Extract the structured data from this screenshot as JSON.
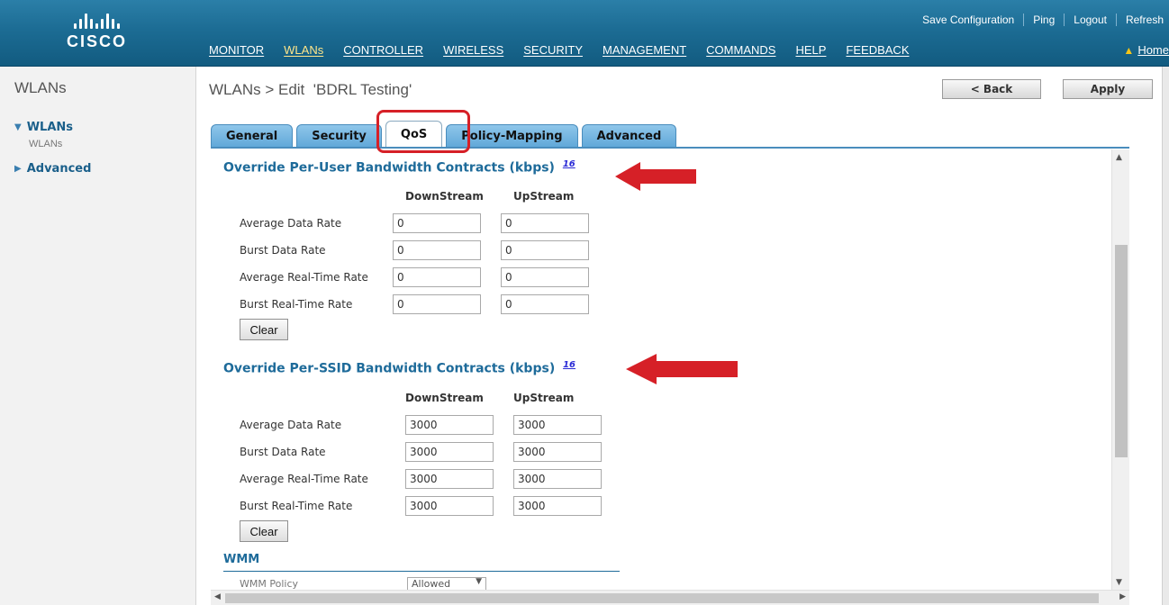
{
  "brand": {
    "name": "CISCO",
    "logo_icon": "cisco-bars-logo"
  },
  "utility_links": [
    "Save Configuration",
    "Ping",
    "Logout",
    "Refresh"
  ],
  "nav": {
    "items": [
      "MONITOR",
      "WLANs",
      "CONTROLLER",
      "WIRELESS",
      "SECURITY",
      "MANAGEMENT",
      "COMMANDS",
      "HELP",
      "FEEDBACK"
    ],
    "active": "WLANs",
    "home_label": "Home",
    "home_icon": "house-icon"
  },
  "sidebar": {
    "title": "WLANs",
    "items": [
      {
        "label": "WLANs",
        "expanded": true,
        "icon": "triangle-down-icon"
      },
      {
        "label": "Advanced",
        "expanded": false,
        "icon": "triangle-right-icon"
      }
    ],
    "sub_item": "WLANs"
  },
  "header": {
    "title": "WLANs > Edit  'BDRL Testing'",
    "back_label": "< Back",
    "apply_label": "Apply"
  },
  "tabs": [
    {
      "label": "General",
      "active": false
    },
    {
      "label": "Security",
      "active": false
    },
    {
      "label": "QoS",
      "active": true
    },
    {
      "label": "Policy-Mapping",
      "active": false
    },
    {
      "label": "Advanced",
      "active": false
    }
  ],
  "per_user": {
    "heading": "Override Per-User Bandwidth Contracts (kbps)",
    "footnote": "16",
    "col_down": "DownStream",
    "col_up": "UpStream",
    "rows": [
      {
        "label": "Average Data Rate",
        "down": "0",
        "up": "0"
      },
      {
        "label": "Burst Data Rate",
        "down": "0",
        "up": "0"
      },
      {
        "label": "Average Real-Time Rate",
        "down": "0",
        "up": "0"
      },
      {
        "label": "Burst Real-Time Rate",
        "down": "0",
        "up": "0"
      }
    ],
    "clear_label": "Clear"
  },
  "per_ssid": {
    "heading": "Override Per-SSID Bandwidth Contracts (kbps)",
    "footnote": "16",
    "col_down": "DownStream",
    "col_up": "UpStream",
    "rows": [
      {
        "label": "Average Data Rate",
        "down": "3000",
        "up": "3000"
      },
      {
        "label": "Burst Data Rate",
        "down": "3000",
        "up": "3000"
      },
      {
        "label": "Average Real-Time Rate",
        "down": "3000",
        "up": "3000"
      },
      {
        "label": "Burst Real-Time Rate",
        "down": "3000",
        "up": "3000"
      }
    ],
    "clear_label": "Clear"
  },
  "wmm": {
    "heading": "WMM",
    "policy_label": "WMM Policy",
    "policy_value": "Allowed"
  },
  "colors": {
    "header_blue": "#1c6c94",
    "tab_blue": "#5fa7d8",
    "section_heading": "#1e6b9a",
    "annotation_red": "#d62027"
  }
}
